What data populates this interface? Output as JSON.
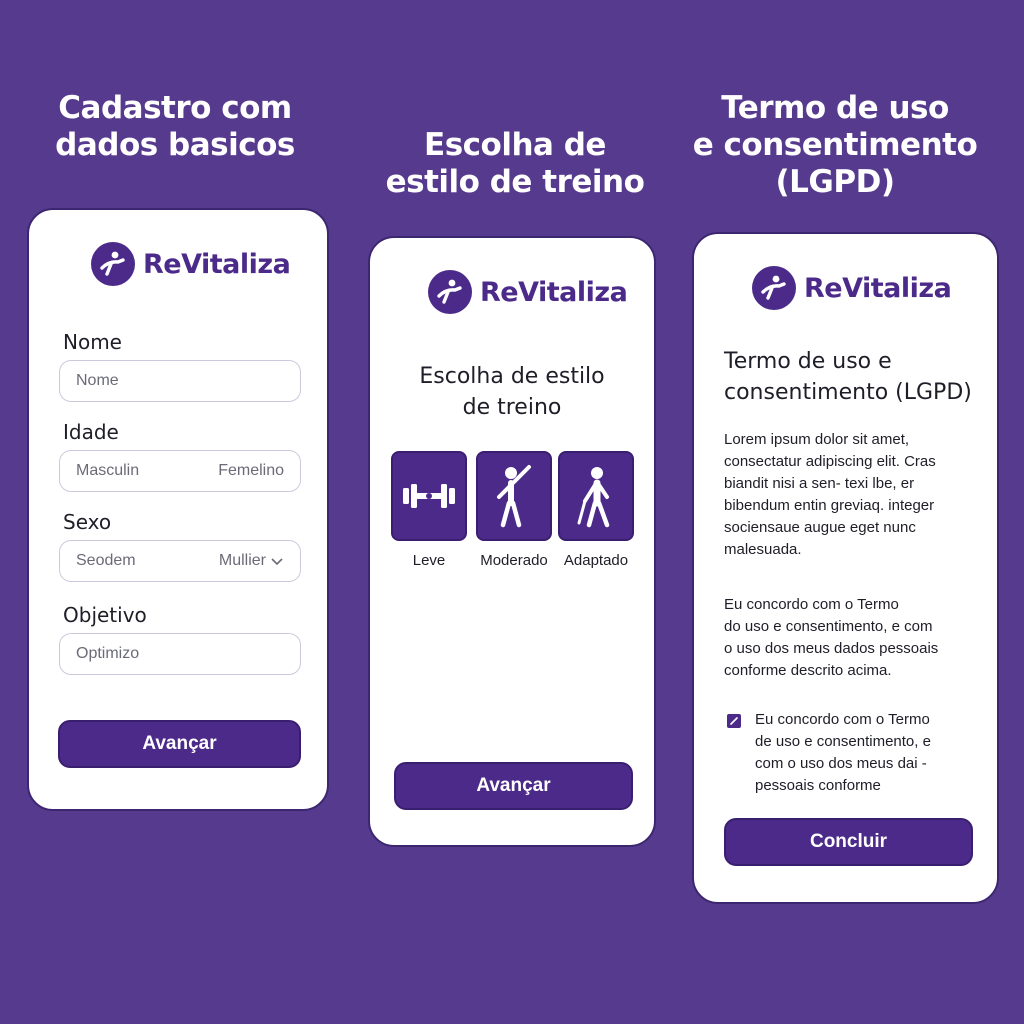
{
  "colors": {
    "background": "#563a8e",
    "accent": "#4b2a8a",
    "card": "#ffffff"
  },
  "headings": {
    "step1": "Cadastro com\ndados basicos",
    "step2": "Escolha de\nestilo de treino",
    "step3": "Termo de uso\ne consentimento\n(LGPD)"
  },
  "brand": {
    "name": "ReVitaliza",
    "logo_icon": "runner-logo-icon"
  },
  "form": {
    "nome": {
      "label": "Nome",
      "placeholder": "Nome"
    },
    "idade": {
      "label": "Idade",
      "option_left": "Masculin",
      "option_right": "Femelino"
    },
    "sexo": {
      "label": "Sexo",
      "option_left": "Seodem",
      "selected": "Mullier",
      "icon": "chevron-down-icon"
    },
    "objetivo": {
      "label": "Objetivo",
      "placeholder": "Optimizo"
    },
    "submit_label": "Avançar"
  },
  "styles": {
    "title": "Escolha de estilo\nde treino",
    "options": [
      {
        "label": "Leve",
        "icon": "dumbbell-icon"
      },
      {
        "label": "Moderado",
        "icon": "person-raising-arm-icon"
      },
      {
        "label": "Adaptado",
        "icon": "person-with-cane-icon"
      }
    ],
    "submit_label": "Avançar"
  },
  "terms": {
    "title": "Termo de uso e\nconsentimento (LGPD)",
    "body": "Lorem ipsum dolor sit amet,\nconsectatur adipiscing elit. Cras\nbiandit nisi a sen- texi lbe, er\nbibendum entin greviaq. integer\nsociensaue augue eget nunc\nmalesuada.",
    "agreement": "Eu concordo com o Termo\ndo uso e consentimento, e com\no uso dos meus dados pessoais\nconforme descrito acima.",
    "checkbox_label": "Eu concordo com o Termo\nde uso e consentimento, e\ncom o uso dos meus dai -\npessoais conforme",
    "checkbox_checked": true,
    "submit_label": "Concluir"
  }
}
